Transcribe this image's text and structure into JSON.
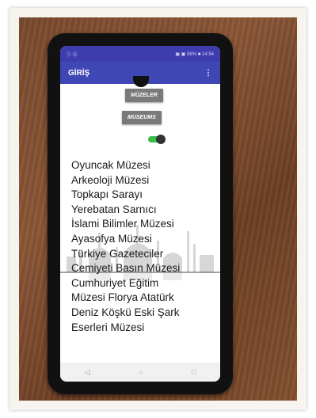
{
  "status_bar": {
    "carrier": "Ⓘ Ⓢ",
    "indicators": "▣ ▣ 56% ■ 14:54"
  },
  "app_bar": {
    "title": "GİRİŞ",
    "menu_label": "⋮"
  },
  "buttons": {
    "muzeler_label": "MÜZELER",
    "museums_label": "MUSEUMS"
  },
  "toggle": {
    "state": "on",
    "track_color": "#39c04a"
  },
  "museum_list": [
    "Oyuncak Müzesi",
    "Arkeoloji Müzesi",
    "Topkapı Sarayı",
    "Yerebatan Sarnıcı",
    "İslami Bilimler Müzesi",
    "Ayasofya Müzesi",
    "Türkiye Gazeteciler",
    "Cemiyeti Basın Müzesi",
    "Cumhuriyet Eğitim",
    "Müzesi    Florya Atatürk",
    "Deniz Köşkü   Eski Şark",
    "Eserleri Müzesi"
  ],
  "nav_bar": {
    "back_icon": "◁",
    "home_icon": "○",
    "recents_icon": "□"
  },
  "colors": {
    "app_bar": "#3f47b5",
    "button": "#7a7a7a"
  }
}
